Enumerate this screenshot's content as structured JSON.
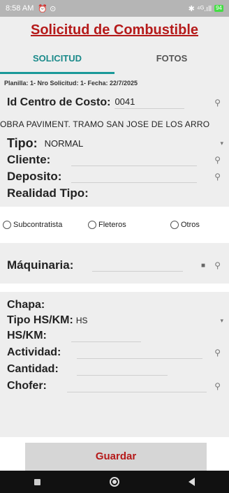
{
  "status": {
    "time": "8:58 AM",
    "icons_left": "⏰ ⊙",
    "icons_right": "✱ ⁴ᴳ.ıll",
    "battery": "94"
  },
  "app": {
    "title": "Solicitud de Combustible"
  },
  "tabs": [
    {
      "label": "SOLICITUD"
    },
    {
      "label": "FOTOS"
    }
  ],
  "form": {
    "planilla": "Planilla: 1- Nro Solicitud: 1- Fecha: 22/7/2025",
    "centro_label": "Id Centro de Costo:",
    "centro_value": "0041",
    "obra": "OBRA PAVIMENT. TRAMO SAN JOSE DE LOS ARRO",
    "tipo_label": "Tipo:",
    "tipo_value": "NORMAL",
    "cliente_label": "Cliente:",
    "deposito_label": "Deposito:",
    "realidad_label": "Realidad Tipo:",
    "radios": [
      "Subcontratista",
      "Fleteros",
      "Otros"
    ],
    "maquinaria_label": "Máquinaria:",
    "chapa_label": "Chapa:",
    "tipohs_label": "Tipo HS/KM:",
    "tipohs_value": "HS",
    "hskm_label": "HS/KM:",
    "actividad_label": "Actividad:",
    "cantidad_label": "Cantidad:",
    "chofer_label": "Chofer:"
  },
  "buttons": {
    "save": "Guardar"
  },
  "icons": {
    "search": "⚲",
    "camera": "■",
    "dropdown": "▾"
  }
}
